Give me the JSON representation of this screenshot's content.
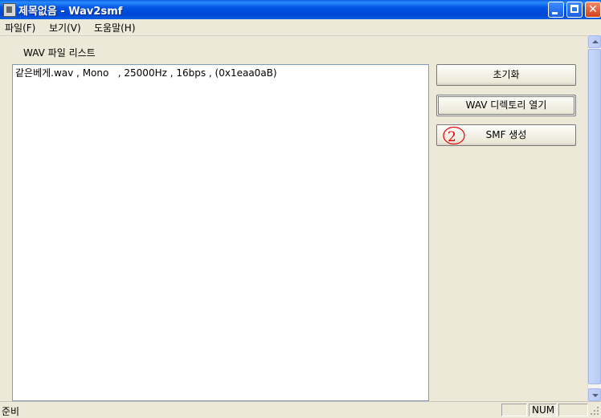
{
  "window": {
    "title": "제목없음 - Wav2smf"
  },
  "menu": [
    {
      "label": "파일(F)"
    },
    {
      "label": "보기(V)"
    },
    {
      "label": "도움말(H)"
    }
  ],
  "list_group": {
    "label": "WAV 파일 리스트",
    "items": [
      "같은베게.wav , Mono   , 25000Hz , 16bps , (0x1eaa0aB)"
    ]
  },
  "buttons": {
    "reset": "초기화",
    "open_dir": "WAV 디렉토리 열기",
    "make_smf": "SMF 생성"
  },
  "annotation": {
    "text": "2",
    "color": "#E00000"
  },
  "statusbar": {
    "text": "준비",
    "panes": [
      "",
      "NUM",
      ""
    ]
  },
  "colors": {
    "titlebar": "#0054E3",
    "face": "#ECE9D8"
  }
}
